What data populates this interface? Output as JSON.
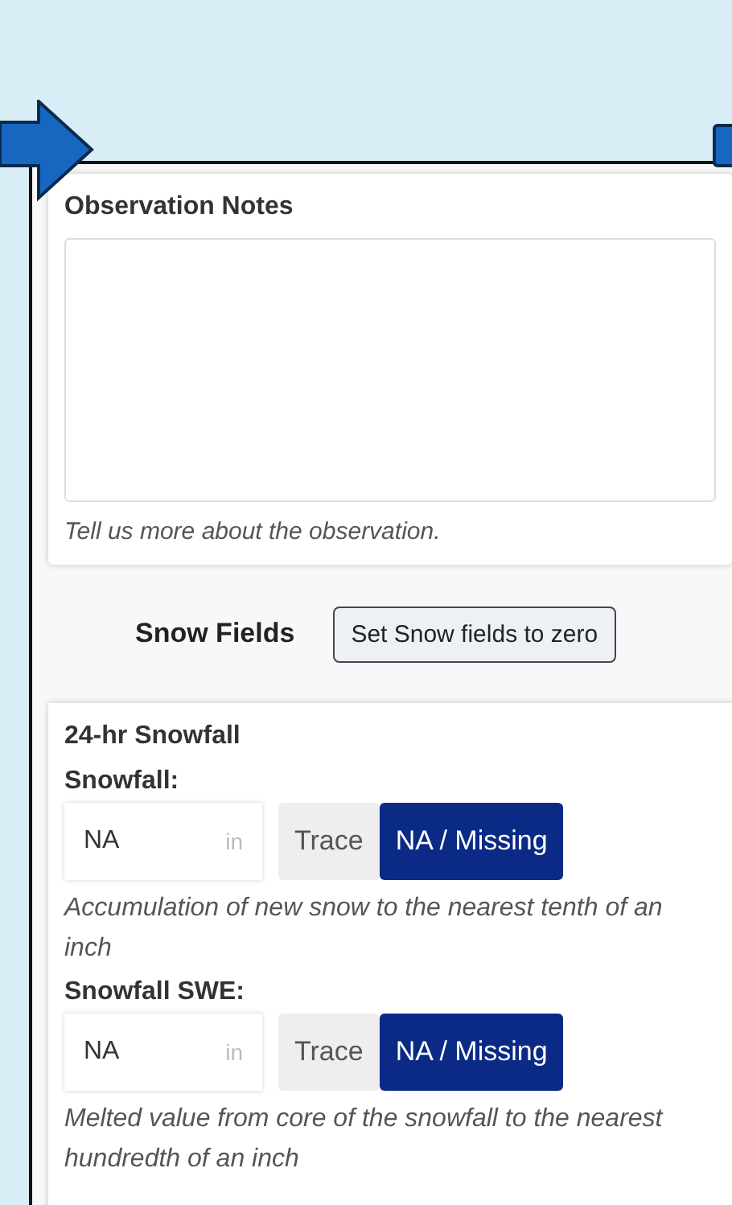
{
  "notes": {
    "title": "Observation Notes",
    "help": "Tell us more about the observation."
  },
  "snow_section": {
    "title": "Snow Fields",
    "button": "Set Snow fields to zero"
  },
  "snowfall_card": {
    "title": "24-hr Snowfall",
    "fields": [
      {
        "label": "Snowfall:",
        "value": "NA",
        "unit": "in",
        "options": [
          {
            "label": "Trace",
            "selected": false
          },
          {
            "label": "NA / Missing",
            "selected": true
          }
        ],
        "help": "Accumulation of new snow to the nearest tenth of an inch"
      },
      {
        "label": "Snowfall SWE:",
        "value": "NA",
        "unit": "in",
        "options": [
          {
            "label": "Trace",
            "selected": false
          },
          {
            "label": "NA / Missing",
            "selected": true
          }
        ],
        "help": "Melted value from core of the snowfall to the nearest hundredth of an inch"
      }
    ]
  }
}
